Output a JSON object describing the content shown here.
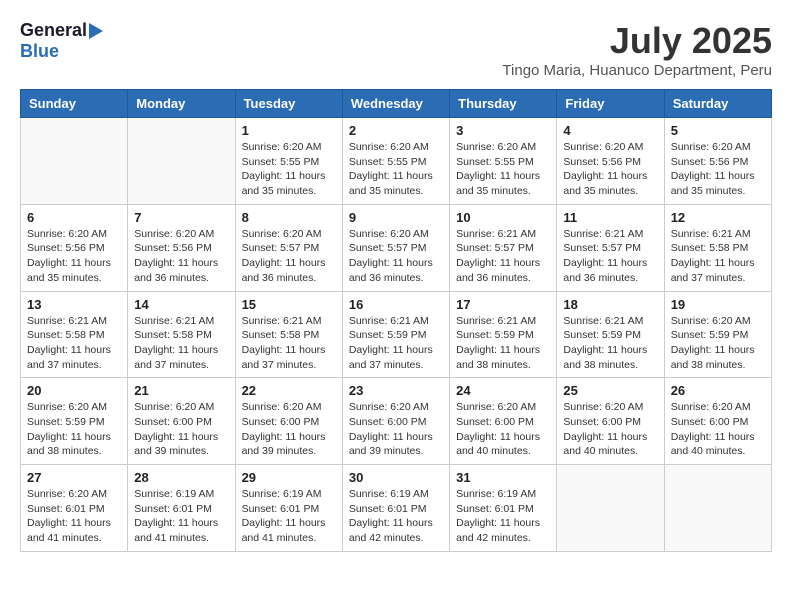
{
  "header": {
    "logo_general": "General",
    "logo_blue": "Blue",
    "month_year": "July 2025",
    "location": "Tingo Maria, Huanuco Department, Peru"
  },
  "calendar": {
    "columns": [
      "Sunday",
      "Monday",
      "Tuesday",
      "Wednesday",
      "Thursday",
      "Friday",
      "Saturday"
    ],
    "weeks": [
      [
        {
          "day": "",
          "info": ""
        },
        {
          "day": "",
          "info": ""
        },
        {
          "day": "1",
          "info": "Sunrise: 6:20 AM\nSunset: 5:55 PM\nDaylight: 11 hours and 35 minutes."
        },
        {
          "day": "2",
          "info": "Sunrise: 6:20 AM\nSunset: 5:55 PM\nDaylight: 11 hours and 35 minutes."
        },
        {
          "day": "3",
          "info": "Sunrise: 6:20 AM\nSunset: 5:55 PM\nDaylight: 11 hours and 35 minutes."
        },
        {
          "day": "4",
          "info": "Sunrise: 6:20 AM\nSunset: 5:56 PM\nDaylight: 11 hours and 35 minutes."
        },
        {
          "day": "5",
          "info": "Sunrise: 6:20 AM\nSunset: 5:56 PM\nDaylight: 11 hours and 35 minutes."
        }
      ],
      [
        {
          "day": "6",
          "info": "Sunrise: 6:20 AM\nSunset: 5:56 PM\nDaylight: 11 hours and 35 minutes."
        },
        {
          "day": "7",
          "info": "Sunrise: 6:20 AM\nSunset: 5:56 PM\nDaylight: 11 hours and 36 minutes."
        },
        {
          "day": "8",
          "info": "Sunrise: 6:20 AM\nSunset: 5:57 PM\nDaylight: 11 hours and 36 minutes."
        },
        {
          "day": "9",
          "info": "Sunrise: 6:20 AM\nSunset: 5:57 PM\nDaylight: 11 hours and 36 minutes."
        },
        {
          "day": "10",
          "info": "Sunrise: 6:21 AM\nSunset: 5:57 PM\nDaylight: 11 hours and 36 minutes."
        },
        {
          "day": "11",
          "info": "Sunrise: 6:21 AM\nSunset: 5:57 PM\nDaylight: 11 hours and 36 minutes."
        },
        {
          "day": "12",
          "info": "Sunrise: 6:21 AM\nSunset: 5:58 PM\nDaylight: 11 hours and 37 minutes."
        }
      ],
      [
        {
          "day": "13",
          "info": "Sunrise: 6:21 AM\nSunset: 5:58 PM\nDaylight: 11 hours and 37 minutes."
        },
        {
          "day": "14",
          "info": "Sunrise: 6:21 AM\nSunset: 5:58 PM\nDaylight: 11 hours and 37 minutes."
        },
        {
          "day": "15",
          "info": "Sunrise: 6:21 AM\nSunset: 5:58 PM\nDaylight: 11 hours and 37 minutes."
        },
        {
          "day": "16",
          "info": "Sunrise: 6:21 AM\nSunset: 5:59 PM\nDaylight: 11 hours and 37 minutes."
        },
        {
          "day": "17",
          "info": "Sunrise: 6:21 AM\nSunset: 5:59 PM\nDaylight: 11 hours and 38 minutes."
        },
        {
          "day": "18",
          "info": "Sunrise: 6:21 AM\nSunset: 5:59 PM\nDaylight: 11 hours and 38 minutes."
        },
        {
          "day": "19",
          "info": "Sunrise: 6:20 AM\nSunset: 5:59 PM\nDaylight: 11 hours and 38 minutes."
        }
      ],
      [
        {
          "day": "20",
          "info": "Sunrise: 6:20 AM\nSunset: 5:59 PM\nDaylight: 11 hours and 38 minutes."
        },
        {
          "day": "21",
          "info": "Sunrise: 6:20 AM\nSunset: 6:00 PM\nDaylight: 11 hours and 39 minutes."
        },
        {
          "day": "22",
          "info": "Sunrise: 6:20 AM\nSunset: 6:00 PM\nDaylight: 11 hours and 39 minutes."
        },
        {
          "day": "23",
          "info": "Sunrise: 6:20 AM\nSunset: 6:00 PM\nDaylight: 11 hours and 39 minutes."
        },
        {
          "day": "24",
          "info": "Sunrise: 6:20 AM\nSunset: 6:00 PM\nDaylight: 11 hours and 40 minutes."
        },
        {
          "day": "25",
          "info": "Sunrise: 6:20 AM\nSunset: 6:00 PM\nDaylight: 11 hours and 40 minutes."
        },
        {
          "day": "26",
          "info": "Sunrise: 6:20 AM\nSunset: 6:00 PM\nDaylight: 11 hours and 40 minutes."
        }
      ],
      [
        {
          "day": "27",
          "info": "Sunrise: 6:20 AM\nSunset: 6:01 PM\nDaylight: 11 hours and 41 minutes."
        },
        {
          "day": "28",
          "info": "Sunrise: 6:19 AM\nSunset: 6:01 PM\nDaylight: 11 hours and 41 minutes."
        },
        {
          "day": "29",
          "info": "Sunrise: 6:19 AM\nSunset: 6:01 PM\nDaylight: 11 hours and 41 minutes."
        },
        {
          "day": "30",
          "info": "Sunrise: 6:19 AM\nSunset: 6:01 PM\nDaylight: 11 hours and 42 minutes."
        },
        {
          "day": "31",
          "info": "Sunrise: 6:19 AM\nSunset: 6:01 PM\nDaylight: 11 hours and 42 minutes."
        },
        {
          "day": "",
          "info": ""
        },
        {
          "day": "",
          "info": ""
        }
      ]
    ]
  }
}
